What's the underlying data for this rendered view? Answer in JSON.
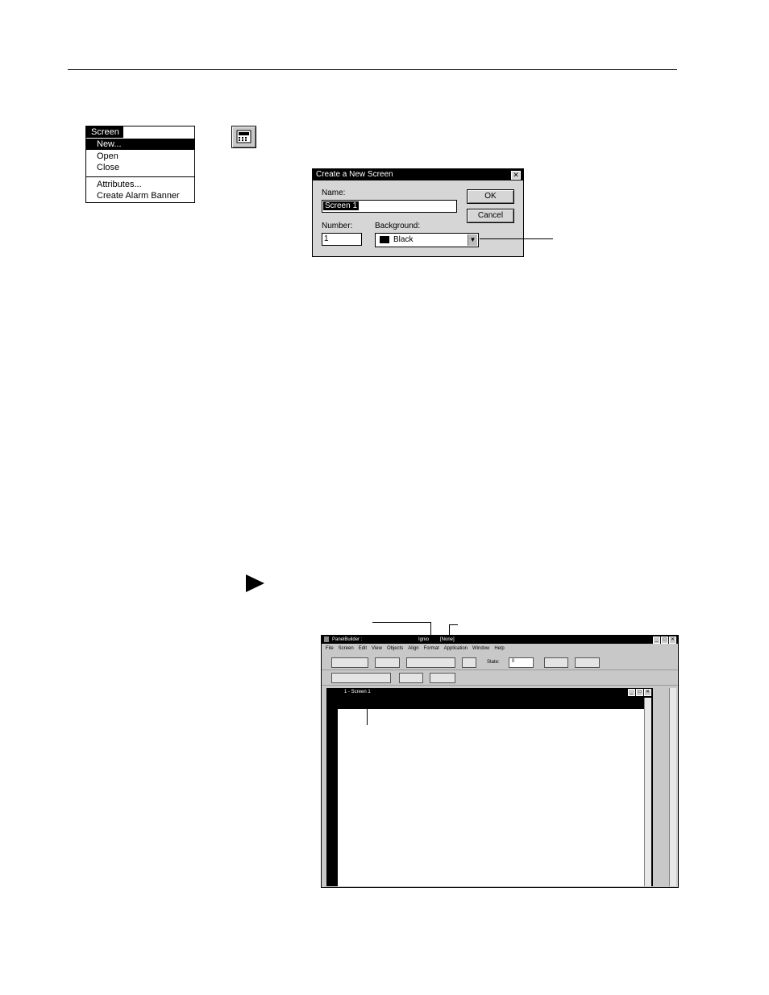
{
  "menu": {
    "title": "Screen",
    "items": [
      "New...",
      "Open",
      "Close",
      "Attributes...",
      "Create Alarm Banner"
    ]
  },
  "dialog": {
    "title": "Create a New Screen",
    "close_glyph": "✕",
    "name_label": "Name:",
    "name_value": "Screen 1",
    "number_label": "Number:",
    "number_value": "1",
    "background_label": "Background:",
    "background_value": "Black",
    "ok_label": "OK",
    "cancel_label": "Cancel",
    "dropdown_glyph": "▼"
  },
  "pb": {
    "title": "PanelBuilder :",
    "file_part": "Ignio",
    "terminal_part": "[None]",
    "menus": [
      "File",
      "Screen",
      "Edit",
      "View",
      "Objects",
      "Align",
      "Format",
      "Application",
      "Window",
      "Help"
    ],
    "state_label": "State:",
    "state_value": "0",
    "doc_title": "1 - Screen 1",
    "win_glyphs": [
      "_",
      "□",
      "✕"
    ]
  }
}
